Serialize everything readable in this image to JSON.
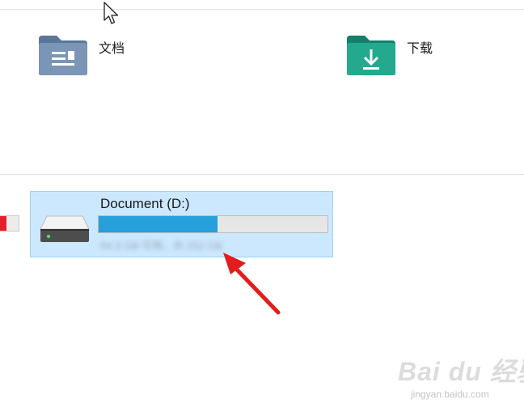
{
  "cursor": {
    "icon": "mouse-pointer-icon"
  },
  "folders": [
    {
      "label": "文档",
      "icon": "documents-folder-icon",
      "color": "#6e8bab"
    },
    {
      "label": "下载",
      "icon": "downloads-folder-icon",
      "color": "#1f9e84"
    }
  ],
  "drive": {
    "name": "Document (D:)",
    "icon": "hard-drive-icon",
    "used_fraction": 0.52,
    "free_space_text": "84.3 GB 可用，共 252 GB",
    "free_space_obscured": true,
    "bar_color": "#26a0da",
    "selected_background": "#cce8ff"
  },
  "partial_drive": {
    "bar_color": "#e2222b"
  },
  "annotation": {
    "icon": "red-arrow-icon",
    "color": "#e31d1d"
  },
  "watermark": {
    "text": "Bai du 经验",
    "subtext": "jingyan.baidu.com"
  }
}
